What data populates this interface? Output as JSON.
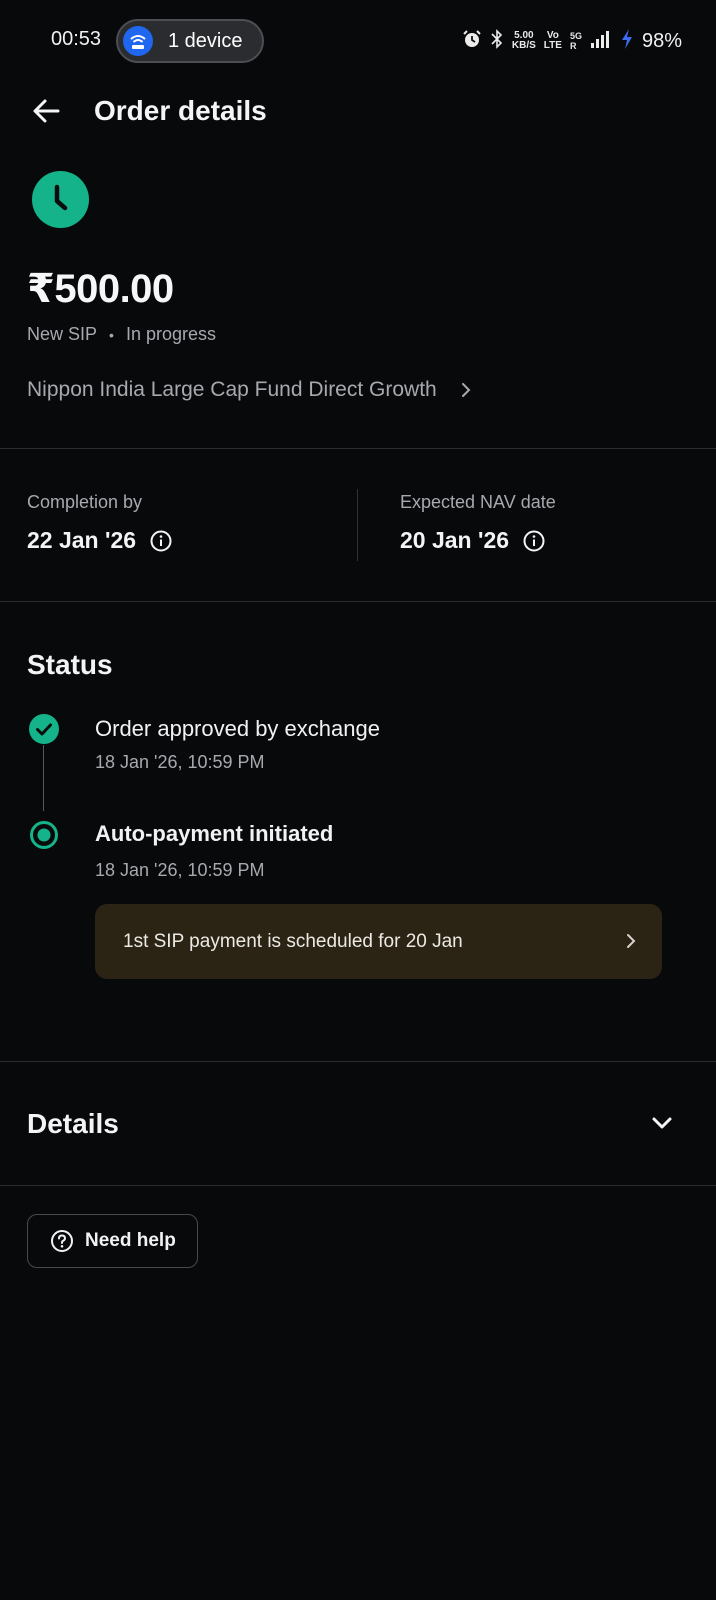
{
  "status_bar": {
    "time": "00:53",
    "hotspot_label": "1 device",
    "net_speed_value": "5.00",
    "net_speed_unit": "KB/S",
    "volte_top": "Vo",
    "volte_bottom": "LTE",
    "network_5g": "5G",
    "network_roaming": "R",
    "battery": "98%"
  },
  "header": {
    "title": "Order details"
  },
  "order": {
    "amount": "₹500.00",
    "type": "New SIP",
    "state": "In progress",
    "fund_name": "Nippon India Large Cap Fund Direct Growth"
  },
  "dates": {
    "completion_label": "Completion by",
    "completion_value": "22 Jan '26",
    "nav_label": "Expected NAV date",
    "nav_value": "20 Jan '26"
  },
  "status": {
    "title": "Status",
    "steps": [
      {
        "title": "Order approved by exchange",
        "time": "18 Jan '26, 10:59 PM"
      },
      {
        "title": "Auto-payment initiated",
        "time": "18 Jan '26, 10:59 PM"
      }
    ],
    "notice": "1st SIP payment is scheduled for 20 Jan"
  },
  "details": {
    "title": "Details"
  },
  "help": {
    "label": "Need help"
  },
  "colors": {
    "background": "#08090b",
    "accent_green": "#14b389",
    "notice_bg": "#2b2314",
    "muted_text": "#a6a9ae"
  }
}
